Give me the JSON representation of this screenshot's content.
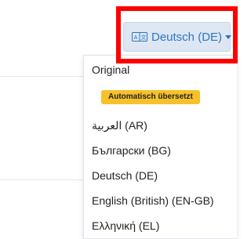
{
  "language_button": {
    "label": "Deutsch (DE)",
    "icon": "translate-icon",
    "chevron_icon": "chevron-down-icon"
  },
  "dropdown": {
    "original_label": "Original",
    "auto_badge": "Automatisch übersetzt",
    "languages": [
      "العربية (AR)",
      "Български (BG)",
      "Deutsch (DE)",
      "English (British) (EN-GB)",
      "Ελληνική (EL)"
    ]
  },
  "colors": {
    "button_bg": "#dde7f3",
    "button_text": "#2f75c0",
    "badge_bg": "#f6c12a",
    "highlight": "#ff0000"
  }
}
